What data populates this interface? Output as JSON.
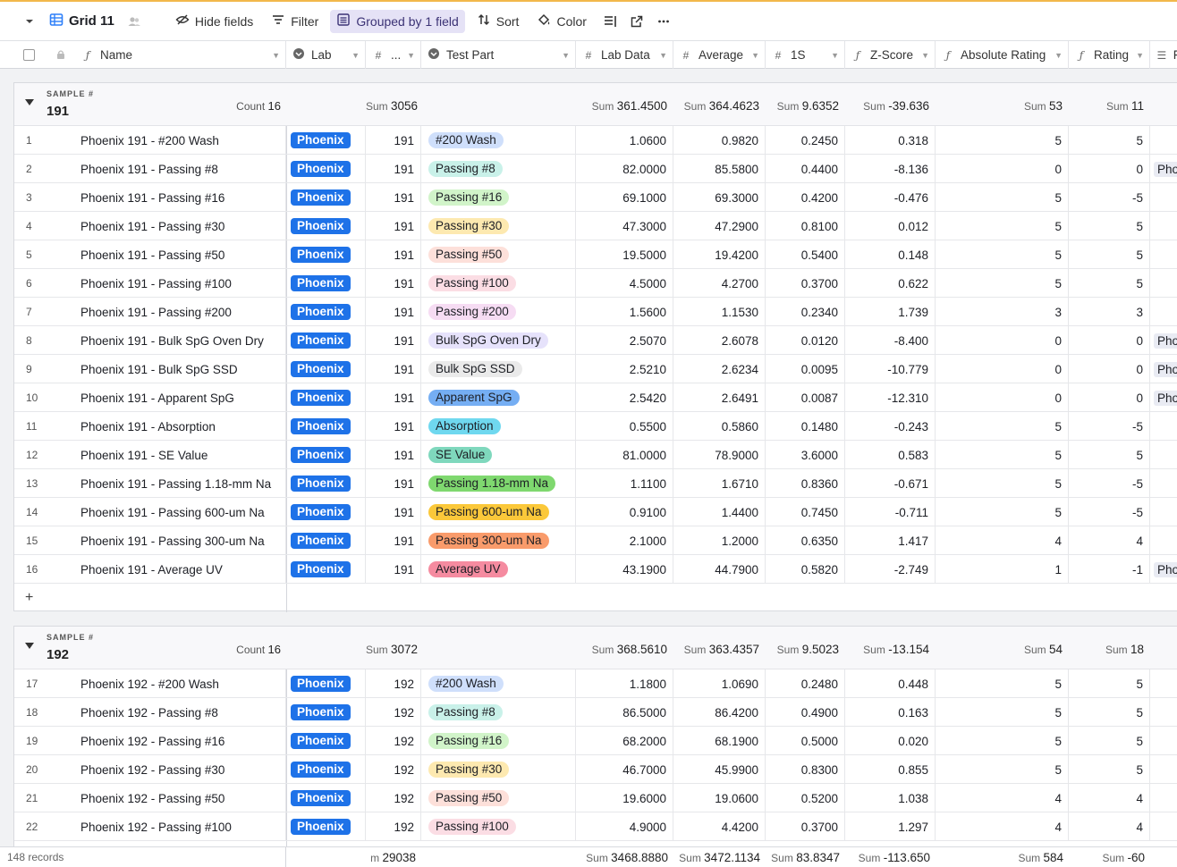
{
  "toolbar": {
    "view_name": "Grid 11",
    "hide_fields": "Hide fields",
    "filter": "Filter",
    "grouped": "Grouped by 1 field",
    "sort": "Sort",
    "color": "Color"
  },
  "columns": {
    "name": "Name",
    "lab": "Lab",
    "sample": "...",
    "test_part": "Test Part",
    "lab_data": "Lab Data",
    "average": "Average",
    "one_s": "1S",
    "z_score": "Z-Score",
    "absolute_rating": "Absolute Rating",
    "rating": "Rating",
    "last": "F"
  },
  "colors": {
    "lab_pill": "#1e72e8",
    "grouped_bg": "#e5e2f6"
  },
  "test_part_colors": {
    "#200 Wash": "#cfdffb",
    "Passing #8": "#c9f1e9",
    "Passing #16": "#d1f4c9",
    "Passing #30": "#fde9b0",
    "Passing #50": "#fde0da",
    "Passing #100": "#fbdde4",
    "Passing #200": "#f6dcf3",
    "Bulk SpG Oven Dry": "#e6e2fb",
    "Bulk SpG SSD": "#eaeaea",
    "Apparent SpG": "#75aef3",
    "Absorption": "#6fd8ef",
    "SE Value": "#7fd8bd",
    "Passing 1.18-mm Na": "#7fd86f",
    "Passing 600-um Na": "#fbc83a",
    "Passing 300-um Na": "#f99b6b",
    "Average UV": "#f58ba0"
  },
  "groups": [
    {
      "label": "SAMPLE #",
      "value": "191",
      "count_label": "Count",
      "count": "16",
      "sums": {
        "sample": "3056",
        "lab_data": "361.4500",
        "average": "364.4623",
        "one_s": "9.6352",
        "z_score": "-39.636",
        "absolute_rating": "53",
        "rating": "11"
      },
      "rows": [
        {
          "n": "1",
          "name": "Phoenix 191 - #200 Wash",
          "lab": "Phoenix",
          "sample": "191",
          "part": "#200 Wash",
          "lab_data": "1.0600",
          "average": "0.9820",
          "one_s": "0.2450",
          "z": "0.318",
          "abs": "5",
          "rating": "5",
          "extra": ""
        },
        {
          "n": "2",
          "name": "Phoenix 191 - Passing #8",
          "lab": "Phoenix",
          "sample": "191",
          "part": "Passing #8",
          "lab_data": "82.0000",
          "average": "85.5800",
          "one_s": "0.4400",
          "z": "-8.136",
          "abs": "0",
          "rating": "0",
          "extra": "Pho"
        },
        {
          "n": "3",
          "name": "Phoenix 191 - Passing #16",
          "lab": "Phoenix",
          "sample": "191",
          "part": "Passing #16",
          "lab_data": "69.1000",
          "average": "69.3000",
          "one_s": "0.4200",
          "z": "-0.476",
          "abs": "5",
          "rating": "-5",
          "extra": ""
        },
        {
          "n": "4",
          "name": "Phoenix 191 - Passing #30",
          "lab": "Phoenix",
          "sample": "191",
          "part": "Passing #30",
          "lab_data": "47.3000",
          "average": "47.2900",
          "one_s": "0.8100",
          "z": "0.012",
          "abs": "5",
          "rating": "5",
          "extra": ""
        },
        {
          "n": "5",
          "name": "Phoenix 191 - Passing #50",
          "lab": "Phoenix",
          "sample": "191",
          "part": "Passing #50",
          "lab_data": "19.5000",
          "average": "19.4200",
          "one_s": "0.5400",
          "z": "0.148",
          "abs": "5",
          "rating": "5",
          "extra": ""
        },
        {
          "n": "6",
          "name": "Phoenix 191 - Passing #100",
          "lab": "Phoenix",
          "sample": "191",
          "part": "Passing #100",
          "lab_data": "4.5000",
          "average": "4.2700",
          "one_s": "0.3700",
          "z": "0.622",
          "abs": "5",
          "rating": "5",
          "extra": ""
        },
        {
          "n": "7",
          "name": "Phoenix 191 - Passing #200",
          "lab": "Phoenix",
          "sample": "191",
          "part": "Passing #200",
          "lab_data": "1.5600",
          "average": "1.1530",
          "one_s": "0.2340",
          "z": "1.739",
          "abs": "3",
          "rating": "3",
          "extra": ""
        },
        {
          "n": "8",
          "name": "Phoenix 191 - Bulk SpG Oven Dry",
          "lab": "Phoenix",
          "sample": "191",
          "part": "Bulk SpG Oven Dry",
          "lab_data": "2.5070",
          "average": "2.6078",
          "one_s": "0.0120",
          "z": "-8.400",
          "abs": "0",
          "rating": "0",
          "extra": "Pho"
        },
        {
          "n": "9",
          "name": "Phoenix 191 - Bulk SpG SSD",
          "lab": "Phoenix",
          "sample": "191",
          "part": "Bulk SpG SSD",
          "lab_data": "2.5210",
          "average": "2.6234",
          "one_s": "0.0095",
          "z": "-10.779",
          "abs": "0",
          "rating": "0",
          "extra": "Pho"
        },
        {
          "n": "10",
          "name": "Phoenix 191 - Apparent SpG",
          "lab": "Phoenix",
          "sample": "191",
          "part": "Apparent SpG",
          "lab_data": "2.5420",
          "average": "2.6491",
          "one_s": "0.0087",
          "z": "-12.310",
          "abs": "0",
          "rating": "0",
          "extra": "Pho"
        },
        {
          "n": "11",
          "name": "Phoenix 191 - Absorption",
          "lab": "Phoenix",
          "sample": "191",
          "part": "Absorption",
          "lab_data": "0.5500",
          "average": "0.5860",
          "one_s": "0.1480",
          "z": "-0.243",
          "abs": "5",
          "rating": "-5",
          "extra": ""
        },
        {
          "n": "12",
          "name": "Phoenix 191 - SE Value",
          "lab": "Phoenix",
          "sample": "191",
          "part": "SE Value",
          "lab_data": "81.0000",
          "average": "78.9000",
          "one_s": "3.6000",
          "z": "0.583",
          "abs": "5",
          "rating": "5",
          "extra": ""
        },
        {
          "n": "13",
          "name": "Phoenix 191 - Passing 1.18-mm Na",
          "lab": "Phoenix",
          "sample": "191",
          "part": "Passing 1.18-mm Na",
          "lab_data": "1.1100",
          "average": "1.6710",
          "one_s": "0.8360",
          "z": "-0.671",
          "abs": "5",
          "rating": "-5",
          "extra": ""
        },
        {
          "n": "14",
          "name": "Phoenix 191 - Passing 600-um Na",
          "lab": "Phoenix",
          "sample": "191",
          "part": "Passing 600-um Na",
          "lab_data": "0.9100",
          "average": "1.4400",
          "one_s": "0.7450",
          "z": "-0.711",
          "abs": "5",
          "rating": "-5",
          "extra": ""
        },
        {
          "n": "15",
          "name": "Phoenix 191 - Passing 300-um Na",
          "lab": "Phoenix",
          "sample": "191",
          "part": "Passing 300-um Na",
          "lab_data": "2.1000",
          "average": "1.2000",
          "one_s": "0.6350",
          "z": "1.417",
          "abs": "4",
          "rating": "4",
          "extra": ""
        },
        {
          "n": "16",
          "name": "Phoenix 191 - Average UV",
          "lab": "Phoenix",
          "sample": "191",
          "part": "Average UV",
          "lab_data": "43.1900",
          "average": "44.7900",
          "one_s": "0.5820",
          "z": "-2.749",
          "abs": "1",
          "rating": "-1",
          "extra": "Pho"
        }
      ]
    },
    {
      "label": "SAMPLE #",
      "value": "192",
      "count_label": "Count",
      "count": "16",
      "sums": {
        "sample": "3072",
        "lab_data": "368.5610",
        "average": "363.4357",
        "one_s": "9.5023",
        "z_score": "-13.154",
        "absolute_rating": "54",
        "rating": "18"
      },
      "rows": [
        {
          "n": "17",
          "name": "Phoenix 192 - #200 Wash",
          "lab": "Phoenix",
          "sample": "192",
          "part": "#200 Wash",
          "lab_data": "1.1800",
          "average": "1.0690",
          "one_s": "0.2480",
          "z": "0.448",
          "abs": "5",
          "rating": "5",
          "extra": ""
        },
        {
          "n": "18",
          "name": "Phoenix 192 - Passing #8",
          "lab": "Phoenix",
          "sample": "192",
          "part": "Passing #8",
          "lab_data": "86.5000",
          "average": "86.4200",
          "one_s": "0.4900",
          "z": "0.163",
          "abs": "5",
          "rating": "5",
          "extra": ""
        },
        {
          "n": "19",
          "name": "Phoenix 192 - Passing #16",
          "lab": "Phoenix",
          "sample": "192",
          "part": "Passing #16",
          "lab_data": "68.2000",
          "average": "68.1900",
          "one_s": "0.5000",
          "z": "0.020",
          "abs": "5",
          "rating": "5",
          "extra": ""
        },
        {
          "n": "20",
          "name": "Phoenix 192 - Passing #30",
          "lab": "Phoenix",
          "sample": "192",
          "part": "Passing #30",
          "lab_data": "46.7000",
          "average": "45.9900",
          "one_s": "0.8300",
          "z": "0.855",
          "abs": "5",
          "rating": "5",
          "extra": ""
        },
        {
          "n": "21",
          "name": "Phoenix 192 - Passing #50",
          "lab": "Phoenix",
          "sample": "192",
          "part": "Passing #50",
          "lab_data": "19.6000",
          "average": "19.0600",
          "one_s": "0.5200",
          "z": "1.038",
          "abs": "4",
          "rating": "4",
          "extra": ""
        },
        {
          "n": "22",
          "name": "Phoenix 192 - Passing #100",
          "lab": "Phoenix",
          "sample": "192",
          "part": "Passing #100",
          "lab_data": "4.9000",
          "average": "4.4200",
          "one_s": "0.3700",
          "z": "1.297",
          "abs": "4",
          "rating": "4",
          "extra": ""
        }
      ]
    }
  ],
  "footer": {
    "records": "148 records",
    "sum_label": "Sum",
    "sample_label": "m",
    "sample": "29038",
    "lab_data": "3468.8880",
    "average": "3472.1134",
    "one_s": "83.8347",
    "z_score": "-113.650",
    "absolute_rating": "584",
    "rating": "-60"
  }
}
